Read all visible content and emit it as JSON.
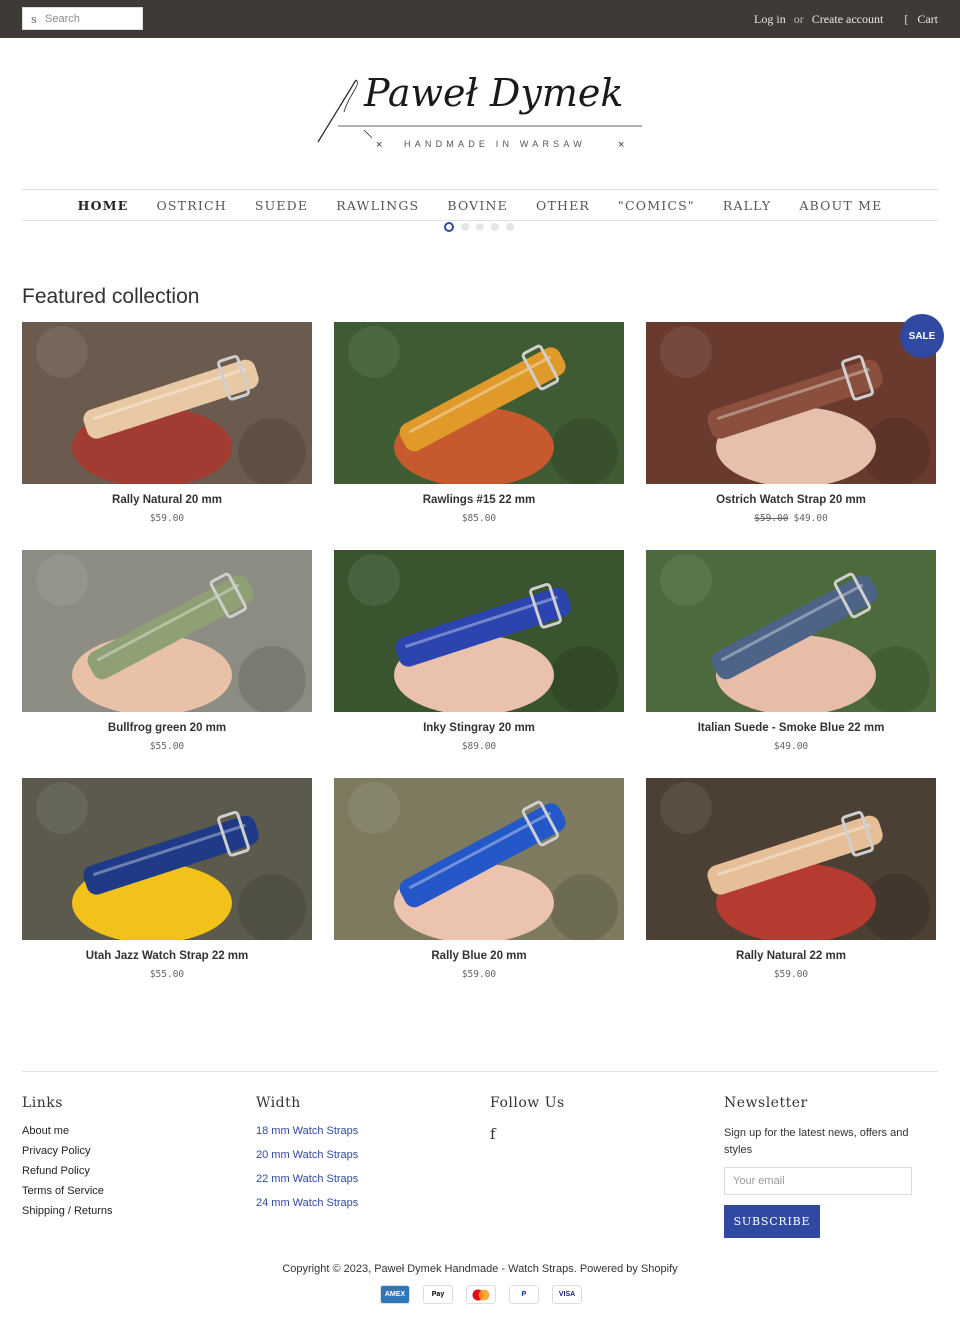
{
  "topbar": {
    "search_placeholder": "Search",
    "search_icon_glyph": "s",
    "login": "Log in",
    "or": "or",
    "create_account": "Create account",
    "cart_icon_glyph": "[",
    "cart": "Cart"
  },
  "logo": {
    "name": "Paweł Dymek",
    "tagline": "HANDMADE IN WARSAW",
    "mark": "×"
  },
  "nav": {
    "items": [
      {
        "label": "HOME",
        "active": true
      },
      {
        "label": "OSTRICH"
      },
      {
        "label": "SUEDE"
      },
      {
        "label": "RAWLINGS"
      },
      {
        "label": "BOVINE"
      },
      {
        "label": "OTHER"
      },
      {
        "label": "\"COMICS\""
      },
      {
        "label": "RALLY"
      },
      {
        "label": "ABOUT ME"
      }
    ],
    "slides": 5,
    "active_slide": 0
  },
  "featured": {
    "title": "Featured collection",
    "sale_badge": "SALE",
    "products": [
      {
        "title": "Rally Natural 20 mm",
        "price": "$59.00",
        "colors": [
          "#6b5a4e",
          "#e9c9a4",
          "#a23b32"
        ]
      },
      {
        "title": "Rawlings #15 22 mm",
        "price": "$85.00",
        "colors": [
          "#3f5b34",
          "#e09a2a",
          "#c65a2e"
        ]
      },
      {
        "title": "Ostrich Watch Strap 20 mm",
        "old_price": "$59.00",
        "price": "$49.00",
        "colors": [
          "#6a3a2e",
          "#8a4f3d",
          "#e7c0ad"
        ]
      },
      {
        "title": "Bullfrog green 20 mm",
        "price": "$55.00",
        "colors": [
          "#8c8c82",
          "#8fa074",
          "#e8c1a8"
        ]
      },
      {
        "title": "Inky Stingray 20 mm",
        "price": "$89.00",
        "colors": [
          "#39542e",
          "#2b44b0",
          "#e9c1ad"
        ]
      },
      {
        "title": "Italian Suede - Smoke Blue 22 mm",
        "price": "$49.00",
        "colors": [
          "#4d6a3c",
          "#4d6488",
          "#e8bda8"
        ]
      },
      {
        "title": "Utah Jazz Watch Strap 22 mm",
        "price": "$55.00",
        "colors": [
          "#5b5a4c",
          "#1f3b88",
          "#f2c21b"
        ]
      },
      {
        "title": "Rally Blue 20 mm",
        "price": "$59.00",
        "colors": [
          "#7d7a60",
          "#2458c8",
          "#ecc3ae"
        ]
      },
      {
        "title": "Rally Natural 22 mm",
        "price": "$59.00",
        "colors": [
          "#4c3f33",
          "#e6bf98",
          "#b53a30"
        ]
      }
    ]
  },
  "footer": {
    "links": {
      "title": "Links",
      "items": [
        "About me",
        "Privacy Policy",
        "Refund Policy",
        "Terms of Service",
        "Shipping / Returns"
      ]
    },
    "width": {
      "title": "Width",
      "items": [
        "18 mm Watch Straps",
        "20 mm Watch Straps",
        "22 mm Watch Straps",
        "24 mm Watch Straps"
      ]
    },
    "follow": {
      "title": "Follow Us",
      "facebook_glyph": "f"
    },
    "newsletter": {
      "title": "Newsletter",
      "text": "Sign up for the latest news, offers and styles",
      "email_placeholder": "Your email",
      "subscribe": "SUBSCRIBE"
    },
    "copyright": "Copyright © 2023, Paweł Dymek Handmade - Watch Straps. Powered by Shopify",
    "payments": [
      {
        "label": "AMEX",
        "color": "#2e77bb"
      },
      {
        "label": "Pay",
        "color": "#000000"
      },
      {
        "label": "",
        "color": "#eb001b"
      },
      {
        "label": "P",
        "color": "#003087"
      },
      {
        "label": "VISA",
        "color": "#1a1f71"
      }
    ]
  },
  "colors": {
    "topbar": "#3e3b37",
    "accent": "#2f4aa0"
  }
}
